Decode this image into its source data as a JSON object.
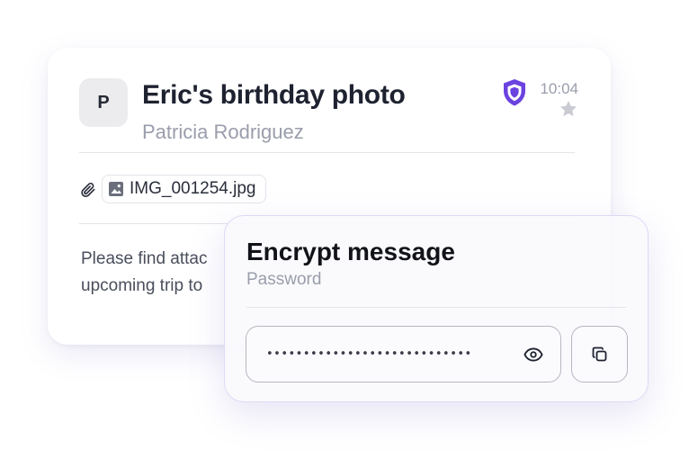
{
  "email": {
    "avatar_initial": "P",
    "subject": "Eric's birthday photo",
    "sender": "Patricia Rodriguez",
    "time": "10:04",
    "attachment": {
      "filename": "IMG_001254.jpg"
    },
    "body_lines": [
      "Please find attac",
      "upcoming trip to"
    ],
    "icons": {
      "shield": "shield-icon",
      "star": "star-icon",
      "paperclip": "paperclip-icon",
      "image": "image-icon"
    }
  },
  "encrypt_modal": {
    "title": "Encrypt message",
    "subtitle": "Password",
    "password_value": "••••••••••••••••••••••••••••",
    "icons": {
      "toggle_visibility": "eye-icon",
      "copy": "copy-icon"
    }
  },
  "colors": {
    "shield_accent": "#6a43e0",
    "star": "#c9cad2",
    "text_primary": "#1e2230",
    "text_muted": "#9a9dab"
  }
}
